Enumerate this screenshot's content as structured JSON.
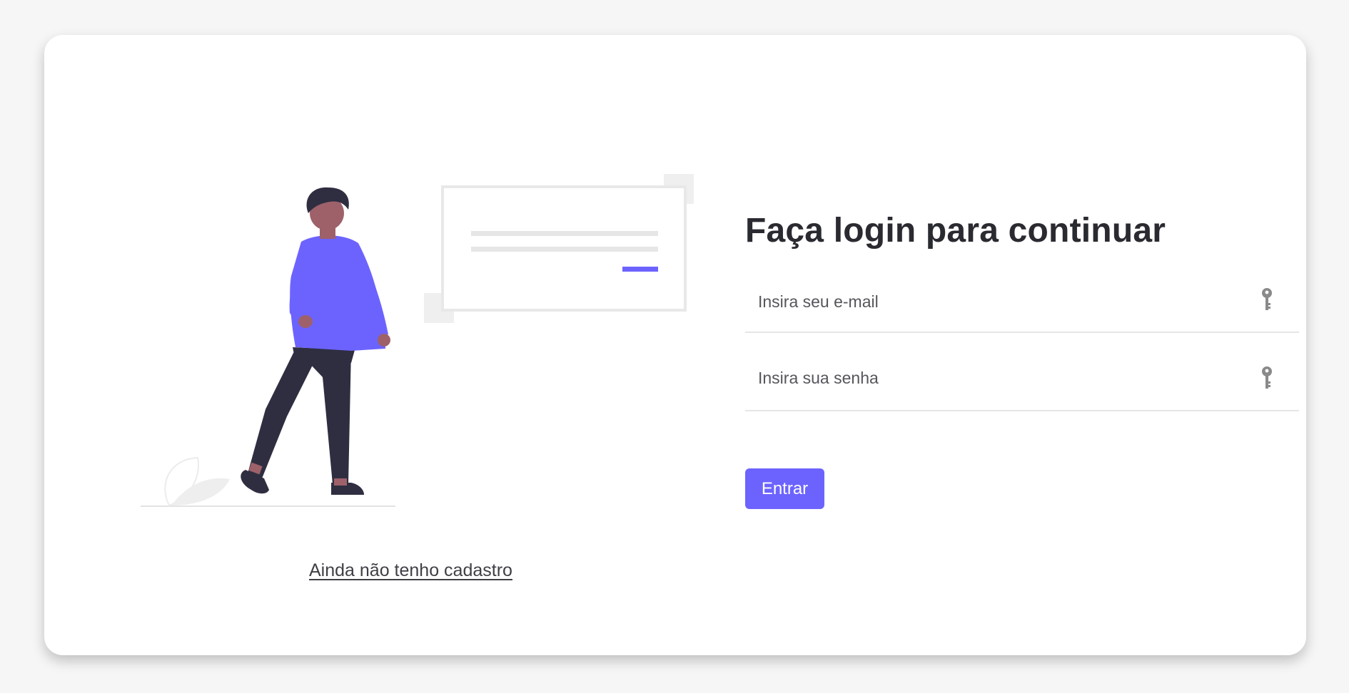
{
  "illustration": {
    "icon": "person-with-card-illustration",
    "accent": "#6c63ff"
  },
  "signup": {
    "link_label": "Ainda não tenho cadastro"
  },
  "form": {
    "title": "Faça login para continuar",
    "email": {
      "placeholder": "Insira seu e-mail",
      "icon": "key-icon"
    },
    "password": {
      "placeholder": "Insira sua senha",
      "icon": "key-icon"
    },
    "submit_label": "Entrar"
  },
  "colors": {
    "accent": "#6c63ff",
    "title": "#2a2a31",
    "background": "#f6f6f6",
    "card": "#ffffff"
  }
}
